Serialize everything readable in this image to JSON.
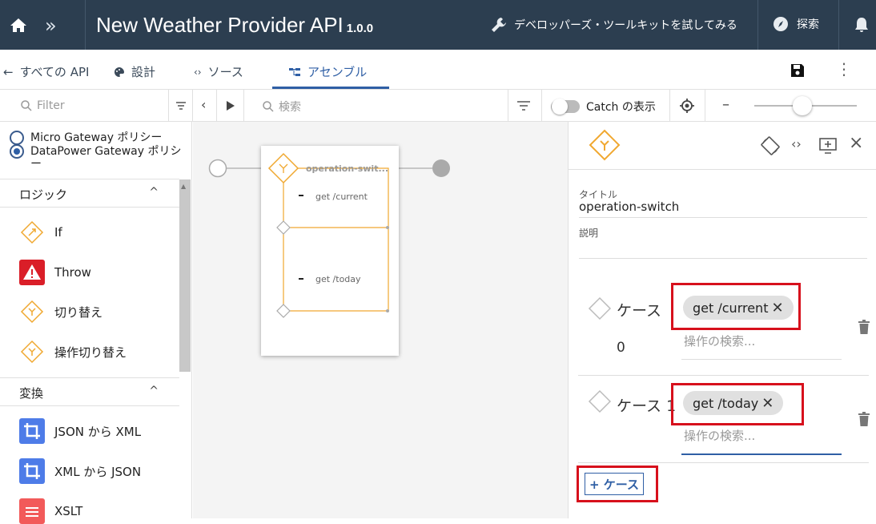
{
  "header": {
    "title": "New Weather Provider API",
    "version": "1.0.0",
    "developer_toolkit": "デベロッパーズ・ツールキットを試してみる",
    "explore": "探索",
    "bg_color": "#2c3e50"
  },
  "tabs": {
    "back": "すべての API",
    "design": "設計",
    "source": "ソース",
    "assemble": "アセンブル",
    "active": "アセンブル"
  },
  "toolbar": {
    "filter_placeholder": "Filter",
    "search_placeholder": "検索",
    "catch_label": "Catch の表示",
    "zoom_minus": "–"
  },
  "left_panel": {
    "gateways": [
      {
        "label": "Micro Gateway ポリシー",
        "selected": false
      },
      {
        "label": "DataPower Gateway ポリシー",
        "selected": true
      }
    ],
    "sections": [
      {
        "title": "ロジック",
        "items": [
          {
            "label": "If",
            "icon": "if-icon"
          },
          {
            "label": "Throw",
            "icon": "throw-icon"
          },
          {
            "label": "切り替え",
            "icon": "switch-icon"
          },
          {
            "label": "操作切り替え",
            "icon": "operation-switch-icon"
          }
        ]
      },
      {
        "title": "変換",
        "items": [
          {
            "label": "JSON から XML",
            "icon": "transform-icon"
          },
          {
            "label": "XML から JSON",
            "icon": "transform-icon"
          },
          {
            "label": "XSLT",
            "icon": "xslt-icon"
          }
        ]
      }
    ]
  },
  "canvas": {
    "node_title": "operation-swit...",
    "cases": [
      "get /current",
      "get /today"
    ]
  },
  "properties": {
    "title_label": "タイトル",
    "title_value": "operation-switch",
    "description_label": "説明",
    "cases": [
      {
        "label_line1": "ケース",
        "label_line2": "0",
        "operation": "get /current",
        "search_placeholder": "操作の検索..."
      },
      {
        "label_line1": "ケース 1",
        "operation": "get /today",
        "search_placeholder": "操作の検索..."
      }
    ],
    "add_case": "+ ケース",
    "highlight_color": "#d7101c",
    "accent_color": "#2f5fa5"
  }
}
